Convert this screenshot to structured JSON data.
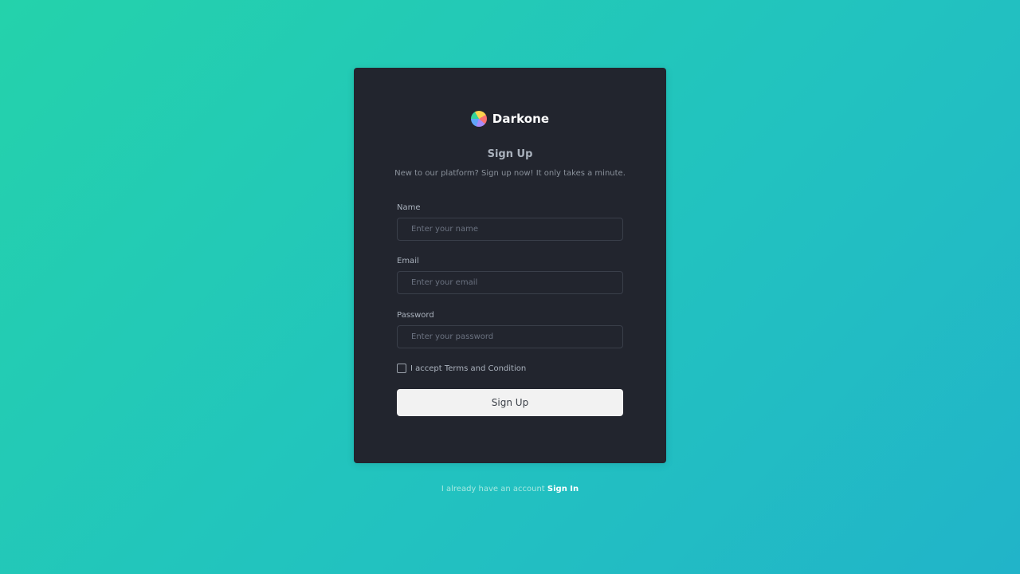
{
  "brand": {
    "name": "Darkone",
    "icon": "colorful-circle-logo-icon"
  },
  "form": {
    "title": "Sign Up",
    "subtitle": "New to our platform? Sign up now! It only takes a minute.",
    "fields": [
      {
        "label": "Name",
        "placeholder": "Enter your name",
        "value": ""
      },
      {
        "label": "Email",
        "placeholder": "Enter your email",
        "value": ""
      },
      {
        "label": "Password",
        "placeholder": "Enter your password",
        "value": ""
      }
    ],
    "terms_label": "I accept Terms and Condition",
    "terms_checked": false,
    "submit_label": "Sign Up"
  },
  "footer": {
    "text": "I already have an account",
    "link_label": "Sign In"
  },
  "colors": {
    "background_start": "#24d2ab",
    "background_end": "#21b4c9",
    "card": "#22252e",
    "button": "#f2f2f2"
  }
}
